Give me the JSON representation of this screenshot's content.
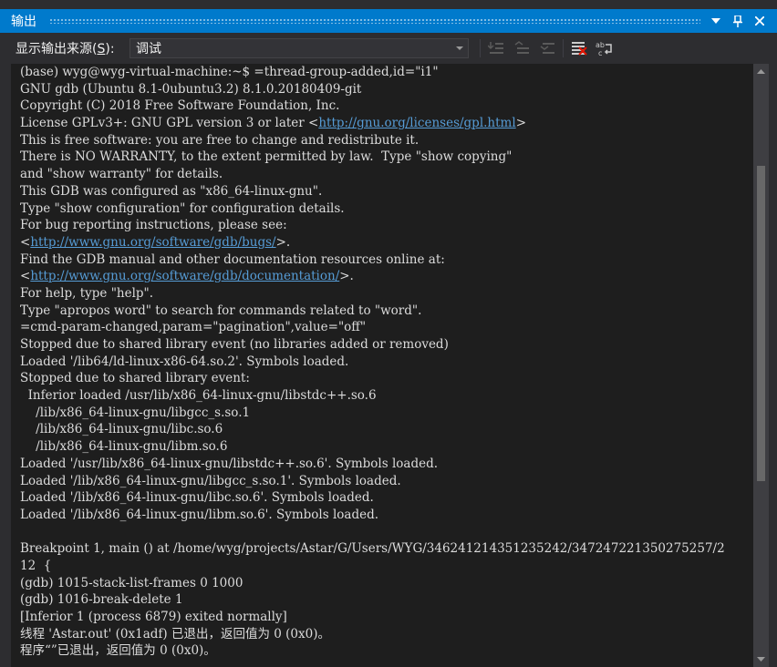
{
  "window": {
    "title": "输出"
  },
  "toolbar": {
    "source_label_prefix": "显示输出来源(",
    "source_label_key": "S",
    "source_label_suffix": "):",
    "source_selected": "调试"
  },
  "output": {
    "lines": [
      {
        "text": "(base) wyg@wyg-virtual-machine:~$ =thread-group-added,id=\"i1\""
      },
      {
        "text": "GNU gdb (Ubuntu 8.1-0ubuntu3.2) 8.1.0.20180409-git"
      },
      {
        "text": "Copyright (C) 2018 Free Software Foundation, Inc."
      },
      {
        "pre": "License GPLv3+: GNU GPL version 3 or later <",
        "link": "http://gnu.org/licenses/gpl.html",
        "post": ">"
      },
      {
        "text": "This is free software: you are free to change and redistribute it."
      },
      {
        "text": "There is NO WARRANTY, to the extent permitted by law.  Type \"show copying\""
      },
      {
        "text": "and \"show warranty\" for details."
      },
      {
        "text": "This GDB was configured as \"x86_64-linux-gnu\"."
      },
      {
        "text": "Type \"show configuration\" for configuration details."
      },
      {
        "text": "For bug reporting instructions, please see:"
      },
      {
        "pre": "<",
        "link": "http://www.gnu.org/software/gdb/bugs/",
        "post": ">."
      },
      {
        "text": "Find the GDB manual and other documentation resources online at:"
      },
      {
        "pre": "<",
        "link": "http://www.gnu.org/software/gdb/documentation/",
        "post": ">."
      },
      {
        "text": "For help, type \"help\"."
      },
      {
        "text": "Type \"apropos word\" to search for commands related to \"word\"."
      },
      {
        "text": "=cmd-param-changed,param=\"pagination\",value=\"off\""
      },
      {
        "text": "Stopped due to shared library event (no libraries added or removed)"
      },
      {
        "text": "Loaded '/lib64/ld-linux-x86-64.so.2'. Symbols loaded."
      },
      {
        "text": "Stopped due to shared library event:"
      },
      {
        "text": "  Inferior loaded /usr/lib/x86_64-linux-gnu/libstdc++.so.6"
      },
      {
        "text": "    /lib/x86_64-linux-gnu/libgcc_s.so.1"
      },
      {
        "text": "    /lib/x86_64-linux-gnu/libc.so.6"
      },
      {
        "text": "    /lib/x86_64-linux-gnu/libm.so.6"
      },
      {
        "text": "Loaded '/usr/lib/x86_64-linux-gnu/libstdc++.so.6'. Symbols loaded."
      },
      {
        "text": "Loaded '/lib/x86_64-linux-gnu/libgcc_s.so.1'. Symbols loaded."
      },
      {
        "text": "Loaded '/lib/x86_64-linux-gnu/libc.so.6'. Symbols loaded."
      },
      {
        "text": "Loaded '/lib/x86_64-linux-gnu/libm.so.6'. Symbols loaded."
      },
      {
        "text": ""
      },
      {
        "text": "Breakpoint 1, main () at /home/wyg/projects/Astar/G/Users/WYG/346241214351235242/347247221350275257/2"
      },
      {
        "text": "12  {"
      },
      {
        "text": "(gdb) 1015-stack-list-frames 0 1000"
      },
      {
        "text": "(gdb) 1016-break-delete 1"
      },
      {
        "text": "[Inferior 1 (process 6879) exited normally]"
      },
      {
        "text": "线程 'Astar.out' (0x1adf) 已退出，返回值为 0 (0x0)。"
      },
      {
        "text": "程序“”已退出，返回值为 0 (0x0)。"
      }
    ]
  },
  "icons": {
    "title_dropdown": "dropdown-icon",
    "title_pin": "pin-icon",
    "title_close": "close-icon",
    "tb_goto_current": "goto-current-icon",
    "tb_prev": "previous-message-icon",
    "tb_next": "next-message-icon",
    "tb_clear": "clear-all-icon",
    "tb_wrap": "word-wrap-icon"
  },
  "colors": {
    "accent": "#007acc",
    "link": "#569cd6",
    "text": "#dcdcdc",
    "background": "#1e1e1e"
  }
}
